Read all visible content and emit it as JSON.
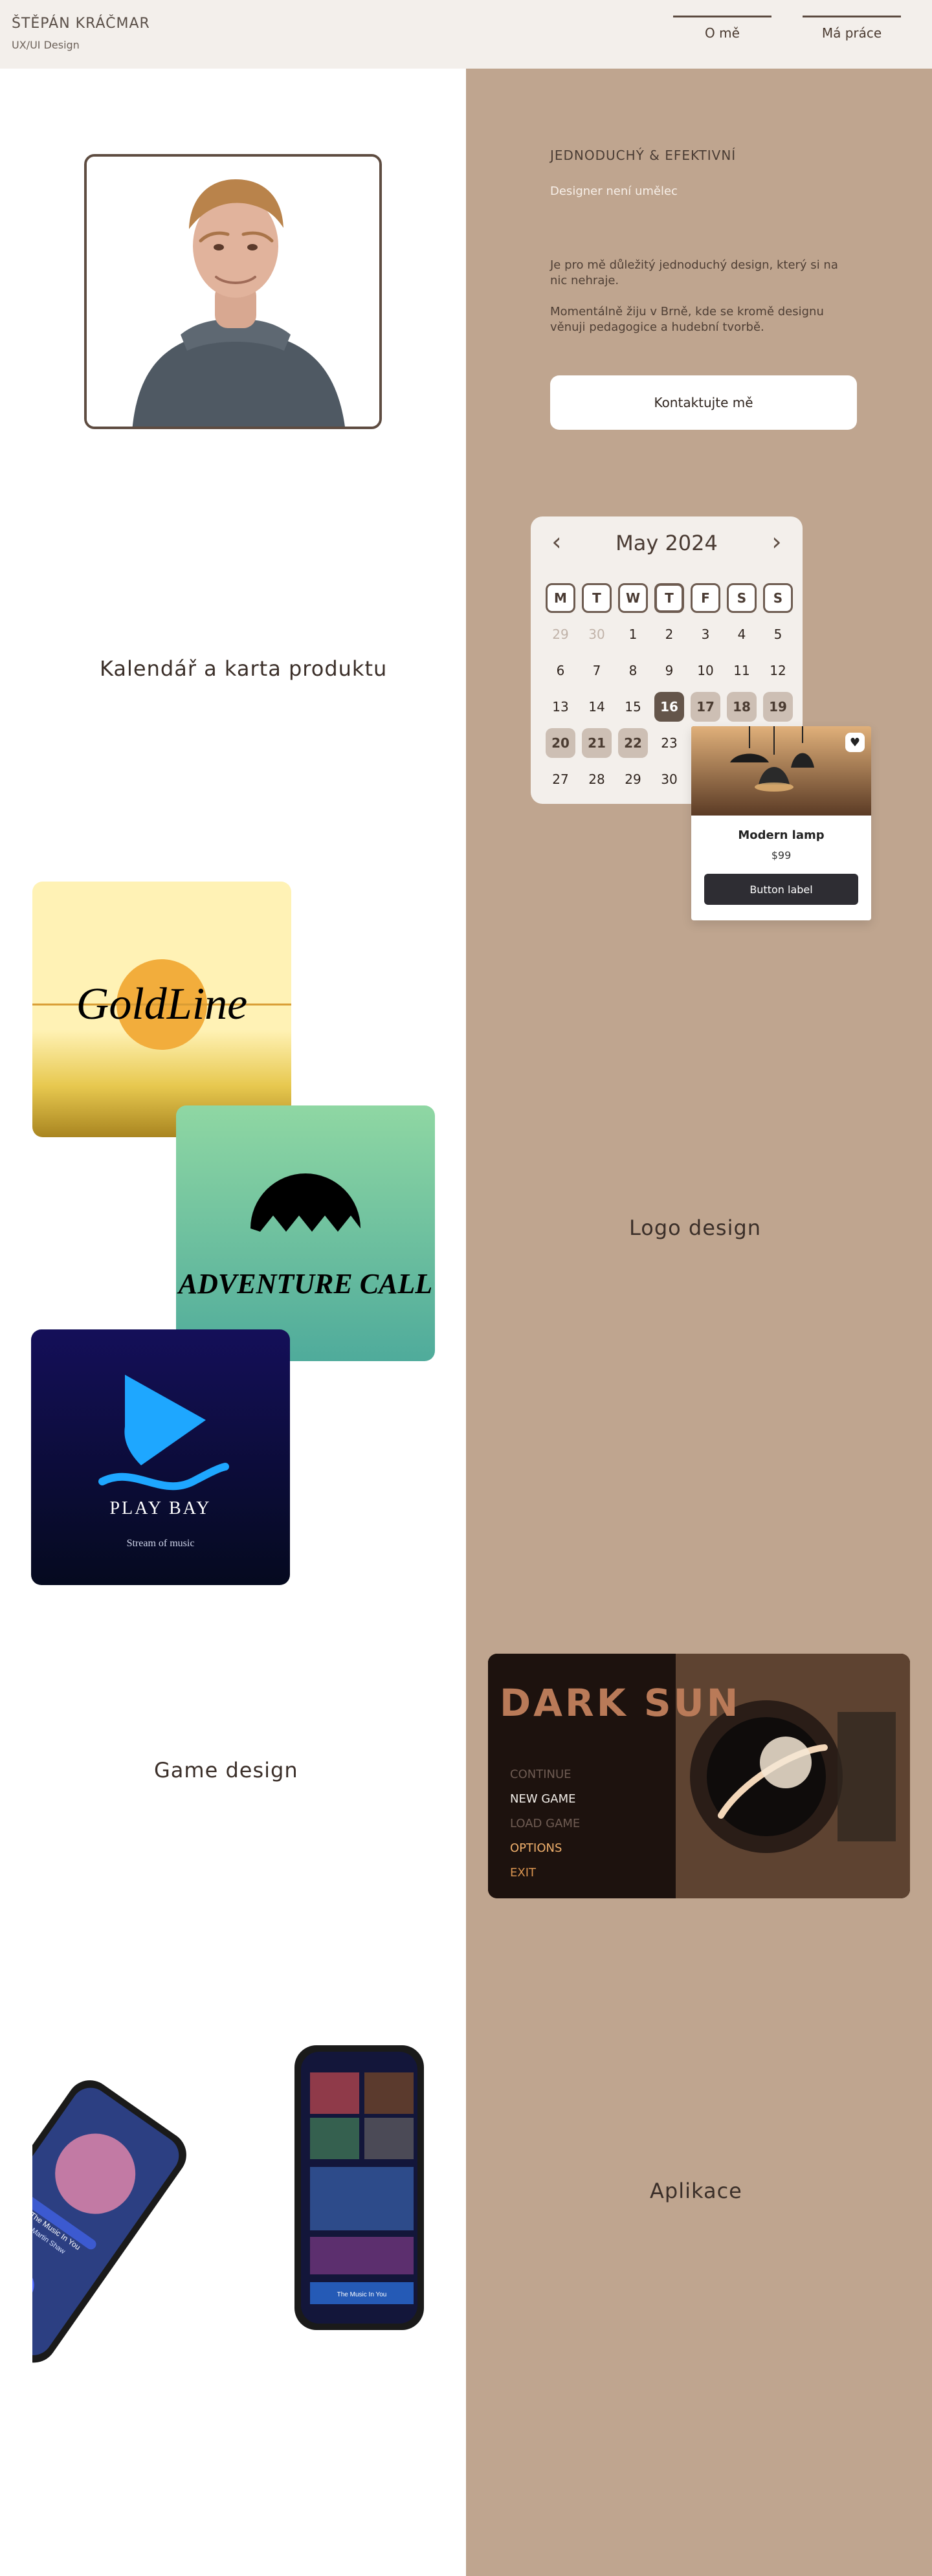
{
  "header": {
    "name": "ŠTĚPÁN KRÁČMAR",
    "subtitle": "UX/UI Design",
    "nav": [
      {
        "label": "O mě"
      },
      {
        "label": "Má práce"
      }
    ]
  },
  "hero": {
    "heading": "JEDNODUCHÝ & EFEKTIVNÍ",
    "subheading": "Designer není umělec",
    "paragraph1": "Je pro mě důležitý jednoduchý design, který si na nic nehraje.",
    "paragraph2": "Momentálně žiju v Brně, kde se kromě designu věnuji pedagogice a hudební tvorbě.",
    "cta": "Kontaktujte mě"
  },
  "sections": {
    "calendar_label": "Kalendář a karta produktu",
    "logo_label": "Logo design",
    "game_label": "Game design",
    "apps_label": "Aplikace"
  },
  "calendar": {
    "title": "May 2024",
    "weekdays": [
      "M",
      "T",
      "W",
      "T",
      "F",
      "S",
      "S"
    ],
    "rows": [
      [
        "29",
        "30",
        "1",
        "2",
        "3",
        "4",
        "5"
      ],
      [
        "6",
        "7",
        "8",
        "9",
        "10",
        "11",
        "12"
      ],
      [
        "13",
        "14",
        "15",
        "16",
        "17",
        "18",
        "19"
      ],
      [
        "20",
        "21",
        "22",
        "23",
        "",
        "",
        ""
      ],
      [
        "27",
        "28",
        "29",
        "30",
        "",
        "",
        ""
      ]
    ]
  },
  "product": {
    "name": "Modern lamp",
    "price": "$99",
    "button": "Button label"
  },
  "logos": {
    "goldline": "GoldLine",
    "adventure": "ADVENTURE CALL",
    "playbay": "PLAY BAY",
    "playbay_sub": "Stream of music"
  },
  "game": {
    "title": "DARK SUN",
    "menu": [
      "CONTINUE",
      "NEW GAME",
      "LOAD GAME",
      "OPTIONS",
      "EXIT"
    ]
  },
  "apps": {
    "song_title": "The Music In You",
    "artist": "Martin Shaw",
    "now_playing": "The Music In You"
  }
}
